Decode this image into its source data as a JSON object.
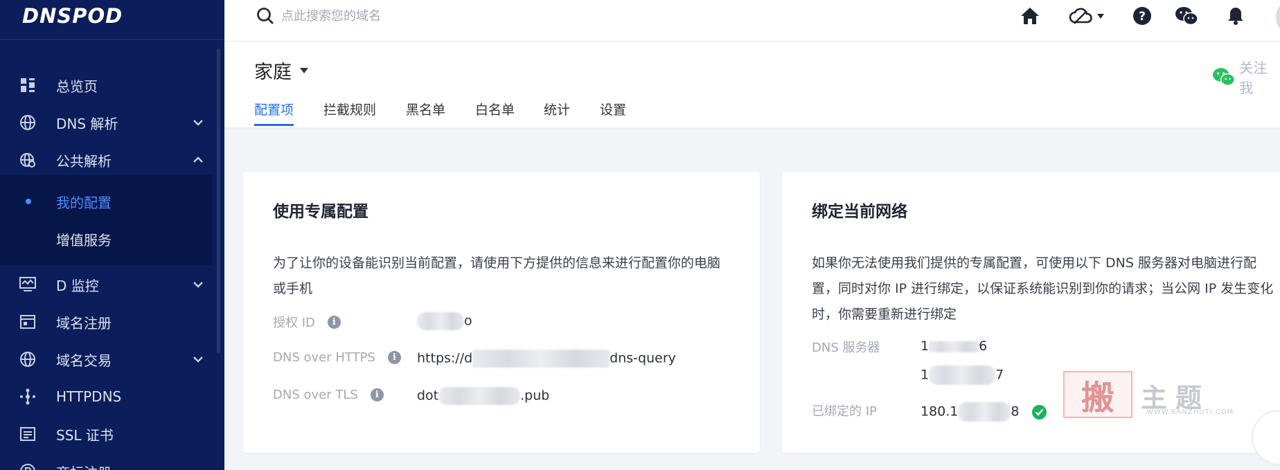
{
  "sidebar": {
    "logo": "DNSPOD",
    "items": [
      {
        "label": "总览页",
        "icon": "dashboard-grid-icon",
        "chevron": ""
      },
      {
        "label": "DNS 解析",
        "icon": "globe-icon",
        "chevron": "down"
      },
      {
        "label": "公共解析",
        "icon": "globe-gear-icon",
        "chevron": "up"
      },
      {
        "label": "D 监控",
        "icon": "monitor-icon",
        "chevron": "down"
      },
      {
        "label": "域名注册",
        "icon": "browser-window-icon",
        "chevron": ""
      },
      {
        "label": "域名交易",
        "icon": "globe-icon",
        "chevron": "down"
      },
      {
        "label": "HTTPDNS",
        "icon": "node-link-icon",
        "chevron": ""
      },
      {
        "label": "SSL 证书",
        "icon": "certificate-icon",
        "chevron": ""
      },
      {
        "label": "商标注册",
        "icon": "registered-icon",
        "chevron": ""
      }
    ],
    "subitems": [
      {
        "label": "我的配置",
        "active": true
      },
      {
        "label": "增值服务",
        "active": false
      }
    ]
  },
  "topbar": {
    "search_placeholder": "点此搜索您的域名",
    "icons": [
      "home-icon",
      "cloud-icon",
      "help-icon",
      "wechat-icon",
      "bell-icon"
    ]
  },
  "header": {
    "title": "家庭",
    "follow_label": "关注我",
    "tabs": [
      "配置项",
      "拦截规则",
      "黑名单",
      "白名单",
      "统计",
      "设置"
    ],
    "active_tab": 0
  },
  "cards": {
    "dedicated": {
      "title": "使用专属配置",
      "desc_line1": "为了让你的设备能识别当前配置，请使用下方提供的信息来进行配置你的电脑",
      "desc_line2": "或手机",
      "rows": [
        {
          "label": "授权 ID",
          "prefix": "",
          "suffix": "o"
        },
        {
          "label": "DNS over HTTPS",
          "prefix": "https://d",
          "suffix": "dns-query"
        },
        {
          "label": "DNS over TLS",
          "prefix": "dot",
          "suffix": ".pub"
        }
      ]
    },
    "bind": {
      "title": "绑定当前网络",
      "desc_line1": "如果你无法使用我们提供的专属配置，可使用以下 DNS 服务器对电脑进行配",
      "desc_line2": "置，同时对你 IP 进行绑定，以保证系统能识别到你的请求；当公网 IP 发生变化",
      "desc_line3": "时，你需要重新进行绑定",
      "dns_label": "DNS 服务器",
      "dns1_prefix": "1",
      "dns1_suffix": "6",
      "dns2_prefix": "1",
      "dns2_suffix": "7",
      "ip_label": "已绑定的 IP",
      "ip_prefix": "180.1",
      "ip_suffix": "8"
    }
  },
  "watermark": {
    "seal": "搬",
    "text": "主题",
    "url": "WWW.BANZHUTI.COM"
  },
  "colors": {
    "sidebar_bg": "#0b1e5b",
    "accent": "#1f6feb",
    "success": "#19b25b"
  }
}
